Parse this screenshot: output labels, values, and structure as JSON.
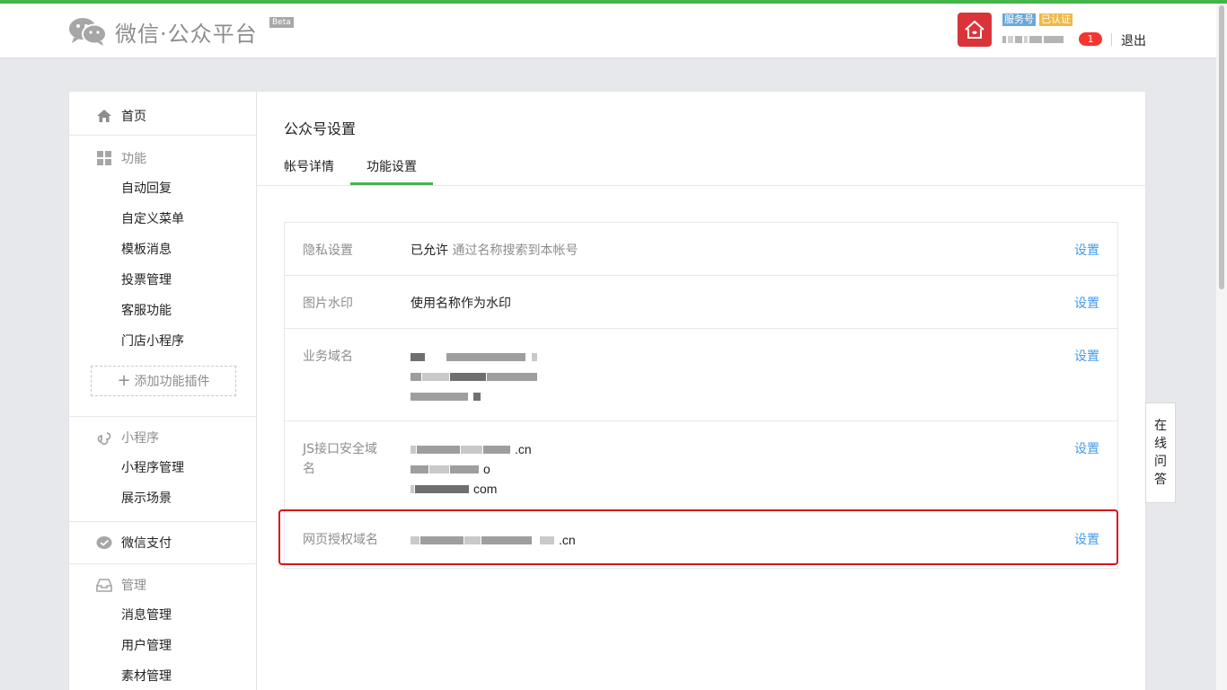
{
  "header": {
    "logo_text": "微信·公众平台",
    "beta": "Beta",
    "badge_service": "服务号",
    "badge_verified": "已认证",
    "notification_count": "1",
    "logout": "退出",
    "accent_color": "#44b549"
  },
  "sidebar": {
    "home": "首页",
    "feature_head": "功能",
    "feature_items": [
      "自动回复",
      "自定义菜单",
      "模板消息",
      "投票管理",
      "客服功能",
      "门店小程序"
    ],
    "add_plugin": "添加功能插件",
    "miniprogram_head": "小程序",
    "miniprogram_items": [
      "小程序管理",
      "展示场景"
    ],
    "wechat_pay": "微信支付",
    "manage_head": "管理",
    "manage_items": [
      "消息管理",
      "用户管理",
      "素材管理"
    ]
  },
  "main": {
    "title": "公众号设置",
    "tabs": [
      {
        "label": "帐号详情",
        "active": false
      },
      {
        "label": "功能设置",
        "active": true
      }
    ],
    "rows": {
      "privacy": {
        "label": "隐私设置",
        "value": "已允许",
        "hint": "通过名称搜索到本帐号",
        "action": "设置"
      },
      "watermark": {
        "label": "图片水印",
        "value": "使用名称作为水印",
        "action": "设置"
      },
      "business_domain": {
        "label": "业务域名",
        "action": "设置"
      },
      "js_domain": {
        "label": "JS接口安全域名",
        "suffixes": [
          ".cn",
          "o",
          "com"
        ],
        "action": "设置"
      },
      "oauth_domain": {
        "label": "网页授权域名",
        "suffix": ".cn",
        "action": "设置"
      }
    }
  },
  "online_qa": {
    "chars": [
      "在",
      "线",
      "问",
      "答"
    ]
  },
  "colors": {
    "link": "#459ae9",
    "highlight_border": "#d7141a"
  }
}
